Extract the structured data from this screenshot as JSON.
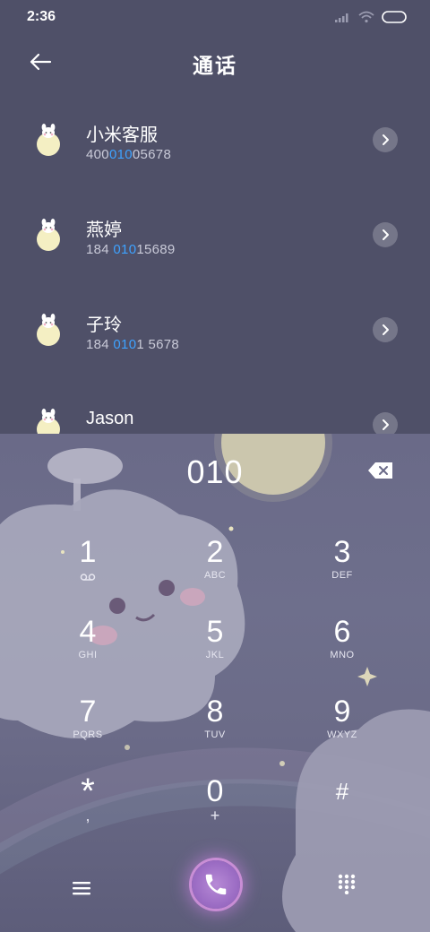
{
  "status": {
    "time": "2:36"
  },
  "header": {
    "title": "通话"
  },
  "contacts": [
    {
      "name": "小米客服",
      "num_pre": "400",
      "num_hl": "010",
      "num_post": "05678"
    },
    {
      "name": "燕婷",
      "num_pre": "184 ",
      "num_hl": "010",
      "num_post": "15689"
    },
    {
      "name": "子玲",
      "num_pre": "184 ",
      "num_hl": "010",
      "num_post": "1 5678"
    },
    {
      "name": "Jason",
      "num_pre": "",
      "num_hl": "",
      "num_post": ""
    }
  ],
  "dialer": {
    "input": "010",
    "keys": [
      {
        "digit": "1",
        "letters": ""
      },
      {
        "digit": "2",
        "letters": "ABC"
      },
      {
        "digit": "3",
        "letters": "DEF"
      },
      {
        "digit": "4",
        "letters": "GHI"
      },
      {
        "digit": "5",
        "letters": "JKL"
      },
      {
        "digit": "6",
        "letters": "MNO"
      },
      {
        "digit": "7",
        "letters": "PQRS"
      },
      {
        "digit": "8",
        "letters": "TUV"
      },
      {
        "digit": "9",
        "letters": "WXYZ"
      },
      {
        "digit": "*",
        "letters": ","
      },
      {
        "digit": "0",
        "letters": "+"
      },
      {
        "digit": "#",
        "letters": ""
      }
    ]
  },
  "icons": {
    "back": "arrow-left-icon",
    "chevron": "chevron-right-icon",
    "voicemail": "voicemail-icon",
    "backspace": "backspace-icon",
    "menu": "menu-icon",
    "call": "phone-icon",
    "keypad": "dialpad-icon"
  },
  "colors": {
    "highlight": "#3ea2ff",
    "call_glow": "#e08cff"
  }
}
